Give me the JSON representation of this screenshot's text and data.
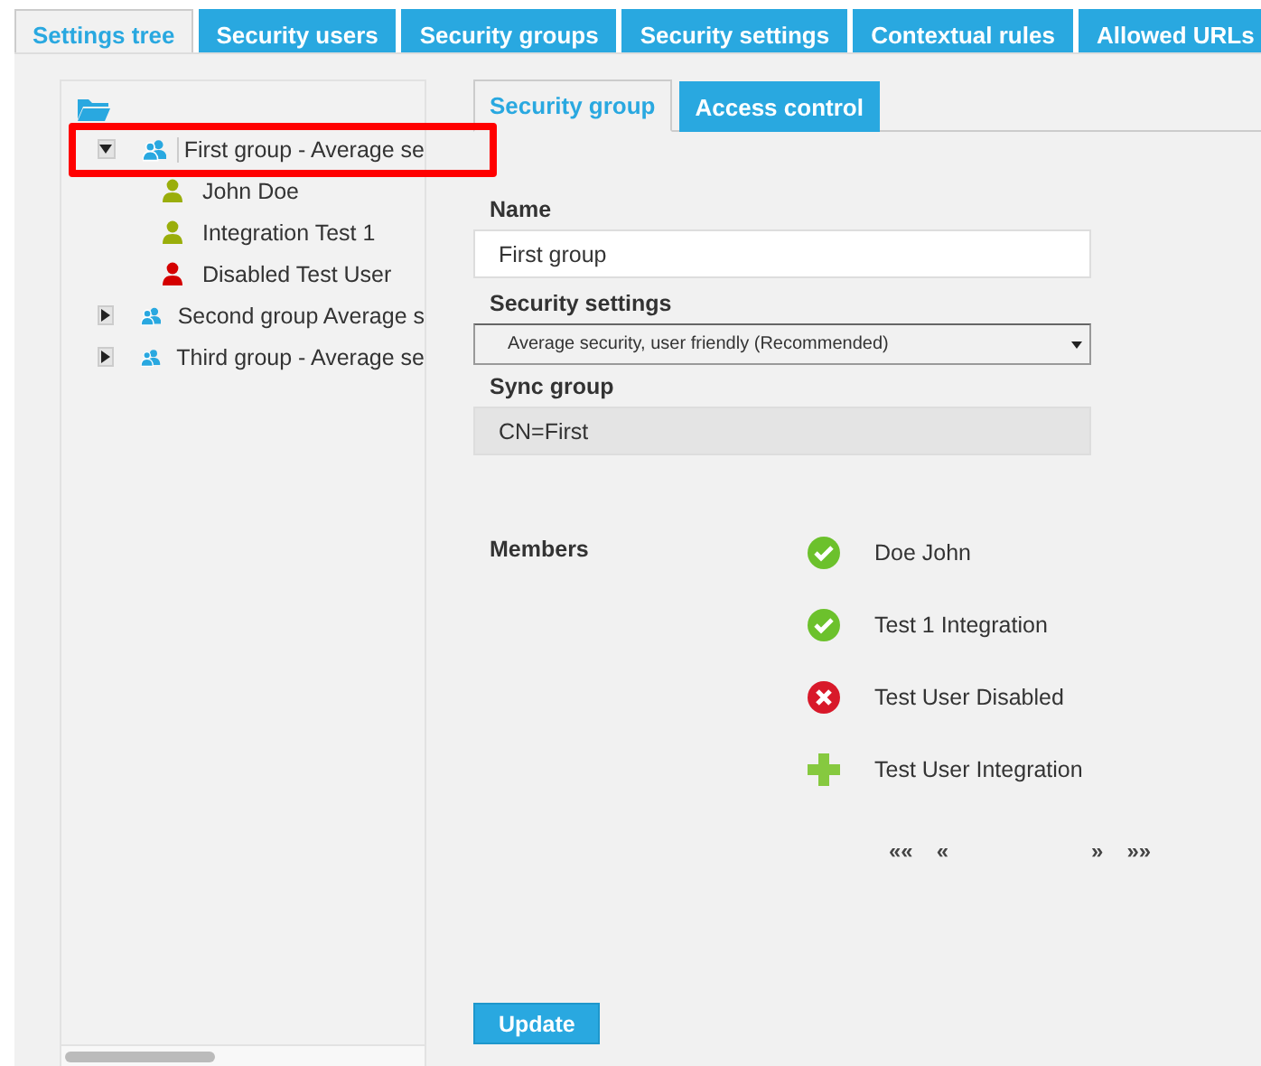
{
  "tabs": [
    {
      "label": "Settings tree",
      "selected": true
    },
    {
      "label": "Security users",
      "selected": false
    },
    {
      "label": "Security groups",
      "selected": false
    },
    {
      "label": "Security settings",
      "selected": false
    },
    {
      "label": "Contextual rules",
      "selected": false
    },
    {
      "label": "Allowed URLs",
      "selected": false
    }
  ],
  "tree": {
    "groups": [
      {
        "label": "First group - Average se",
        "expanded": true,
        "highlighted": true,
        "selected": true,
        "children": [
          {
            "label": "John Doe",
            "color": "#9aae0b",
            "selected": false
          },
          {
            "label": "Integration Test 1",
            "color": "#9aae0b",
            "selected": false
          },
          {
            "label": "Disabled Test User",
            "color": "#d40000",
            "selected": false
          }
        ]
      },
      {
        "label": "Second group Average s",
        "expanded": false,
        "highlighted": false,
        "selected": false
      },
      {
        "label": "Third group - Average se",
        "expanded": false,
        "highlighted": false,
        "selected": false
      }
    ]
  },
  "form_tabs": [
    {
      "label": "Security group",
      "selected": true
    },
    {
      "label": "Access control",
      "selected": false
    }
  ],
  "fields": [
    {
      "label": "Name",
      "kind": "text",
      "value": "First group"
    },
    {
      "label": "Security settings",
      "kind": "select",
      "value": "Average security, user friendly (Recommended)"
    },
    {
      "label": "Sync group",
      "kind": "readonly",
      "value": "CN=First"
    }
  ],
  "members": {
    "label": "Members",
    "items": [
      {
        "name": "Doe John",
        "kind": "member"
      },
      {
        "name": "Test 1 Integration",
        "kind": "member"
      },
      {
        "name": "Test User Disabled",
        "kind": "disabled"
      },
      {
        "name": "Test User Integration",
        "kind": "add"
      }
    ],
    "pager": {
      "first": "««",
      "prev": "«",
      "next": "»",
      "last": "»»"
    }
  },
  "update_button": "Update"
}
